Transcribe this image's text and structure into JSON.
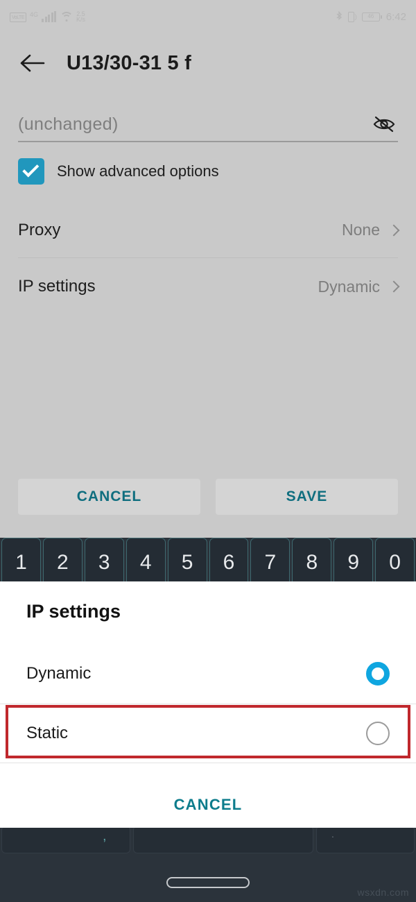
{
  "status_bar": {
    "volte_label": "VoLTE",
    "network_type": "4G",
    "data_rate_value": "2.5",
    "data_rate_unit": "K/s",
    "bluetooth_icon": "bluetooth-icon",
    "vibrate_icon": "vibrate-icon",
    "battery_percent": "46",
    "time": "6:42"
  },
  "app_bar": {
    "back_icon": "back-arrow-icon",
    "title": "U13/30-31 5 f"
  },
  "form": {
    "password_value": "(unchanged)",
    "password_visibility_icon": "eye-off-icon",
    "advanced_checkbox_label": "Show advanced options",
    "advanced_checkbox_checked": true,
    "rows": [
      {
        "label": "Proxy",
        "value": "None"
      },
      {
        "label": "IP settings",
        "value": "Dynamic"
      }
    ],
    "cancel_label": "CANCEL",
    "save_label": "SAVE"
  },
  "keyboard": {
    "number_row": [
      "1",
      "2",
      "3",
      "4",
      "5",
      "6",
      "7",
      "8",
      "9",
      "0"
    ]
  },
  "dialog": {
    "title": "IP settings",
    "options": [
      {
        "label": "Dynamic",
        "selected": true
      },
      {
        "label": "Static",
        "selected": false
      }
    ],
    "cancel_label": "CANCEL",
    "highlighted_option": "Static"
  },
  "nav": {
    "home_pill": "home-gesture-pill"
  },
  "watermark": "wsxdn.com",
  "colors": {
    "page_background": "#c9c9c9",
    "accent_teal": "#0d7c8c",
    "checkbox_teal": "#2197bd",
    "radio_selected": "#0fa6e0",
    "annotation_red": "#c0282d",
    "keyboard_background": "#2b333b",
    "key_outline": "#3f6a70",
    "dialog_background": "#ffffff"
  }
}
